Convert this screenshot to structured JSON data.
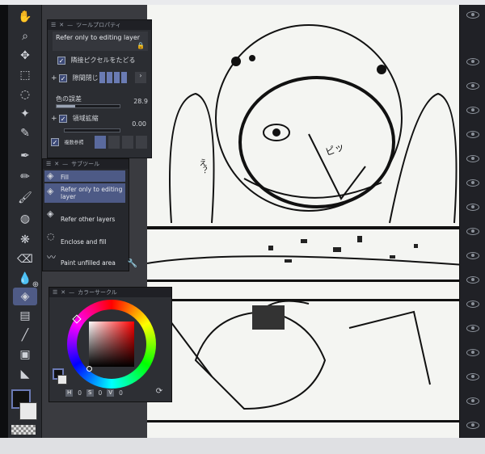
{
  "tool_property": {
    "title": "ツールプロパティ",
    "reference_dropdown": "Refer only to editing layer",
    "adjacent_pixels_label": "隣接ピクセルをたどる",
    "close_gap_label": "隙間閉じ",
    "color_margin_label": "色の誤差",
    "color_margin_value": "28.9",
    "area_scaling_label": "領域拡縮",
    "area_scaling_value": "0.00",
    "multi_ref_label": "複数参照"
  },
  "sub_tool": {
    "title": "サブツール",
    "items": [
      {
        "label": "Fill",
        "icon": "bucket-icon",
        "selected": true
      },
      {
        "label": "Refer only to editing layer",
        "icon": "bucket-icon",
        "selected": true
      },
      {
        "label": "Refer other layers",
        "icon": "bucket-icon",
        "selected": false
      },
      {
        "label": "Enclose and fill",
        "icon": "lasso-fill-icon",
        "selected": false
      },
      {
        "label": "Paint unfilled area",
        "icon": "brush-fill-icon",
        "selected": false
      }
    ]
  },
  "color_circle": {
    "title": "カラーサークル",
    "hsv": {
      "h_key": "H",
      "h": "0",
      "s_key": "S",
      "s": "0",
      "v_key": "V",
      "v": "0"
    }
  },
  "canvas": {
    "speech_bubble_text": "え？",
    "sfx_text": "ピッ"
  },
  "colors": {
    "accent": "#4f5b86",
    "main_color": "#111111",
    "sub_color": "#e9e9e9"
  }
}
